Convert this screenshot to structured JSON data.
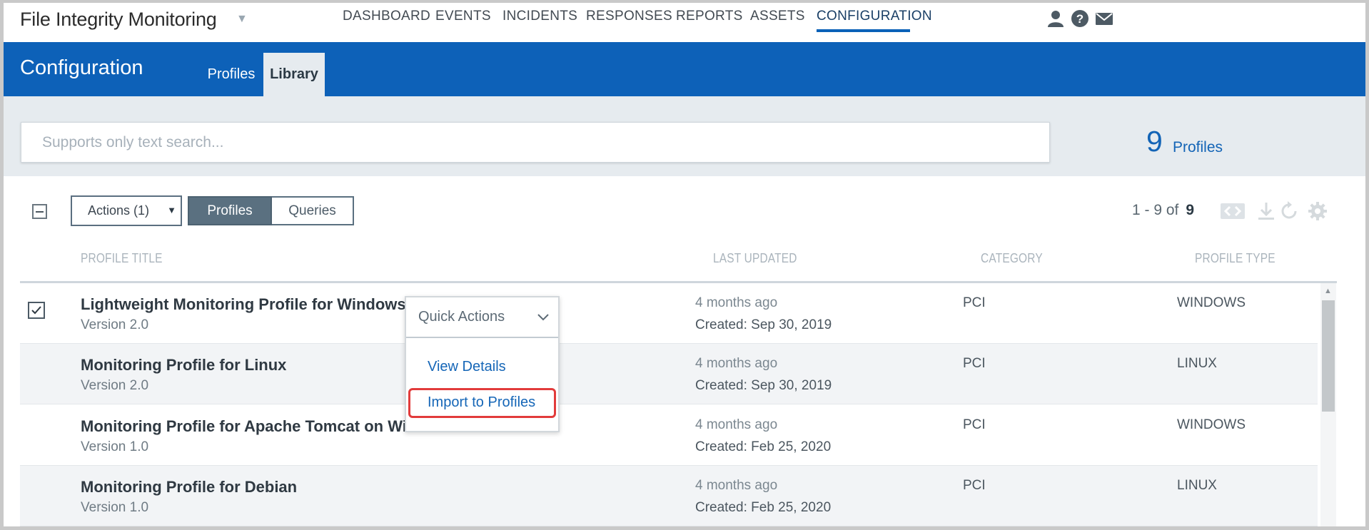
{
  "app": {
    "title": "File Integrity Monitoring"
  },
  "nav": {
    "items": [
      "DASHBOARD",
      "EVENTS",
      "INCIDENTS",
      "RESPONSES",
      "REPORTS",
      "ASSETS",
      "CONFIGURATION"
    ],
    "active": "CONFIGURATION"
  },
  "header": {
    "title": "Configuration",
    "tabs": [
      "Profiles",
      "Library"
    ],
    "active_tab": "Library"
  },
  "search": {
    "placeholder": "Supports only text search...",
    "value": ""
  },
  "summary": {
    "count": "9",
    "label": "Profiles"
  },
  "toolbar": {
    "actions_label": "Actions (1)",
    "segments": [
      "Profiles",
      "Queries"
    ],
    "active_segment": "Profiles",
    "pager_range": "1 - 9 of",
    "pager_total": "9"
  },
  "table": {
    "columns": [
      "PROFILE TITLE",
      "LAST UPDATED",
      "CATEGORY",
      "PROFILE TYPE"
    ],
    "rows": [
      {
        "title": "Lightweight Monitoring Profile for Windows",
        "version": "Version 2.0",
        "updated": "4 months ago",
        "created": "Created: Sep 30, 2019",
        "category": "PCI",
        "type": "WINDOWS",
        "checked": true
      },
      {
        "title": "Monitoring Profile for Linux",
        "version": "Version 2.0",
        "updated": "4 months ago",
        "created": "Created: Sep 30, 2019",
        "category": "PCI",
        "type": "LINUX",
        "checked": false
      },
      {
        "title": "Monitoring Profile for Apache Tomcat on Win",
        "version": "Version 1.0",
        "updated": "4 months ago",
        "created": "Created: Feb 25, 2020",
        "category": "PCI",
        "type": "WINDOWS",
        "checked": false
      },
      {
        "title": "Monitoring Profile for Debian",
        "version": "Version 1.0",
        "updated": "4 months ago",
        "created": "Created: Feb 25, 2020",
        "category": "PCI",
        "type": "LINUX",
        "checked": false
      }
    ]
  },
  "quick_actions": {
    "label": "Quick Actions",
    "items": [
      "View Details",
      "Import to Profiles"
    ],
    "highlighted": "Import to Profiles"
  },
  "colors": {
    "brand_blue": "#0d61b8",
    "highlight_red": "#e23b3b"
  },
  "icons": [
    "user-icon",
    "help-icon",
    "mail-icon",
    "pager-icon",
    "download-icon",
    "refresh-icon",
    "settings-icon",
    "chevron-down-icon",
    "checkmark-icon"
  ]
}
